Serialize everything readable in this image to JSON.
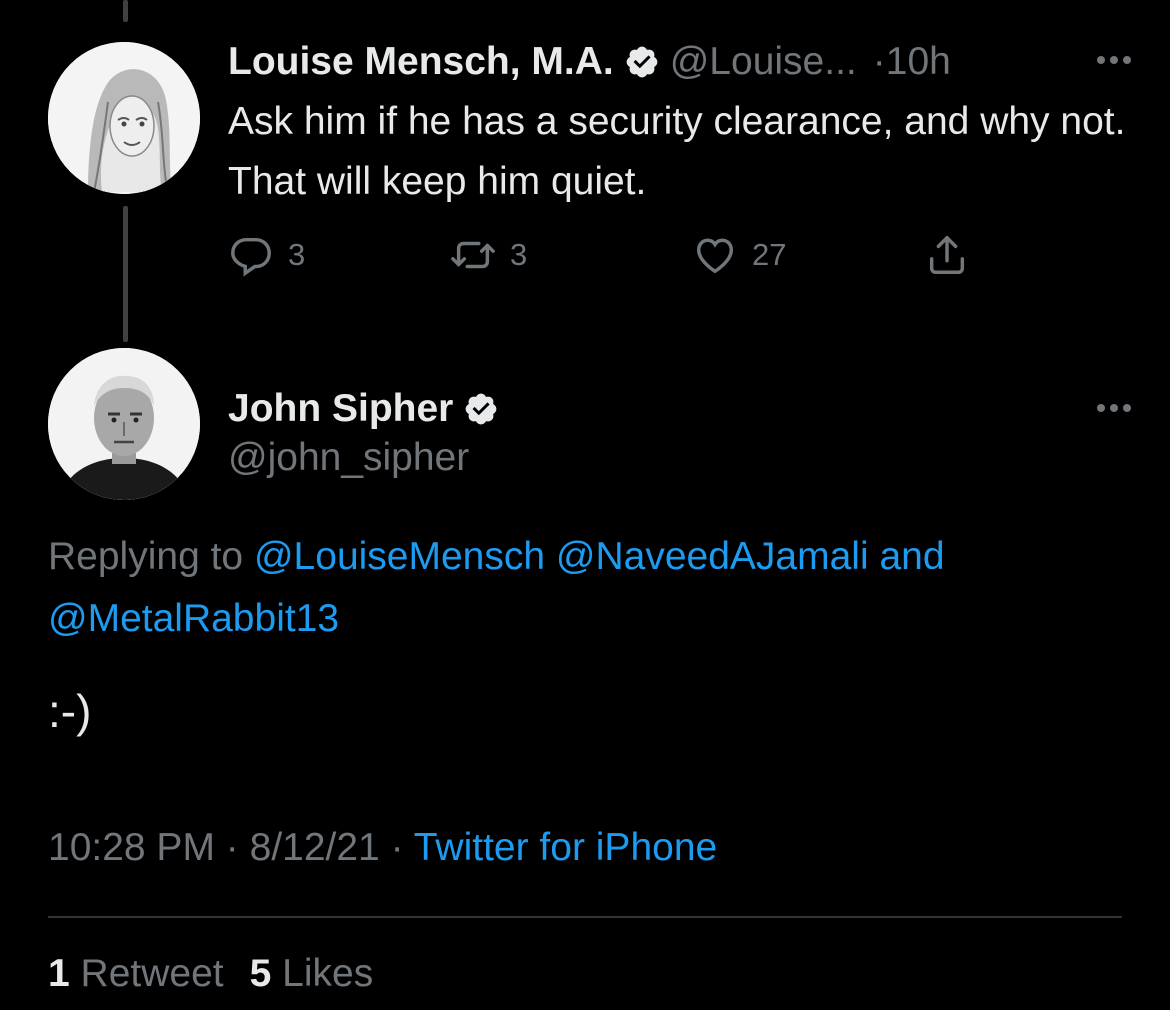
{
  "parent_tweet": {
    "display_name": "Louise Mensch, M.A.",
    "handle": "@Louise...",
    "separator": "·",
    "time": "10h",
    "text": "Ask him if he has a security clearance, and why not. That will keep him quiet.",
    "reply_count": "3",
    "retweet_count": "3",
    "like_count": "27",
    "icons": {
      "verified": "verified-badge-icon",
      "more": "more-options-icon",
      "reply": "reply-icon",
      "retweet": "retweet-icon",
      "like": "heart-icon",
      "share": "share-icon"
    }
  },
  "main_tweet": {
    "display_name": "John Sipher",
    "handle": "@john_sipher",
    "replying_prefix": "Replying to",
    "mention_1": "@LouiseMensch",
    "mention_2": "@NaveedAJamali",
    "mention_connector": "and",
    "mention_3": "@MetalRabbit13",
    "text": ":-)",
    "time": "10:28 PM",
    "meta_separator": "·",
    "date": "8/12/21",
    "source": "Twitter for iPhone",
    "retweet_count": "1",
    "retweet_label": "Retweet",
    "like_count": "5",
    "like_label": "Likes"
  },
  "colors": {
    "background": "#000000",
    "primary_text": "#e7e9ea",
    "secondary_text": "#71767b",
    "accent": "#1d9bf0",
    "thread_line": "#3e4144",
    "divider": "#2f3336"
  }
}
